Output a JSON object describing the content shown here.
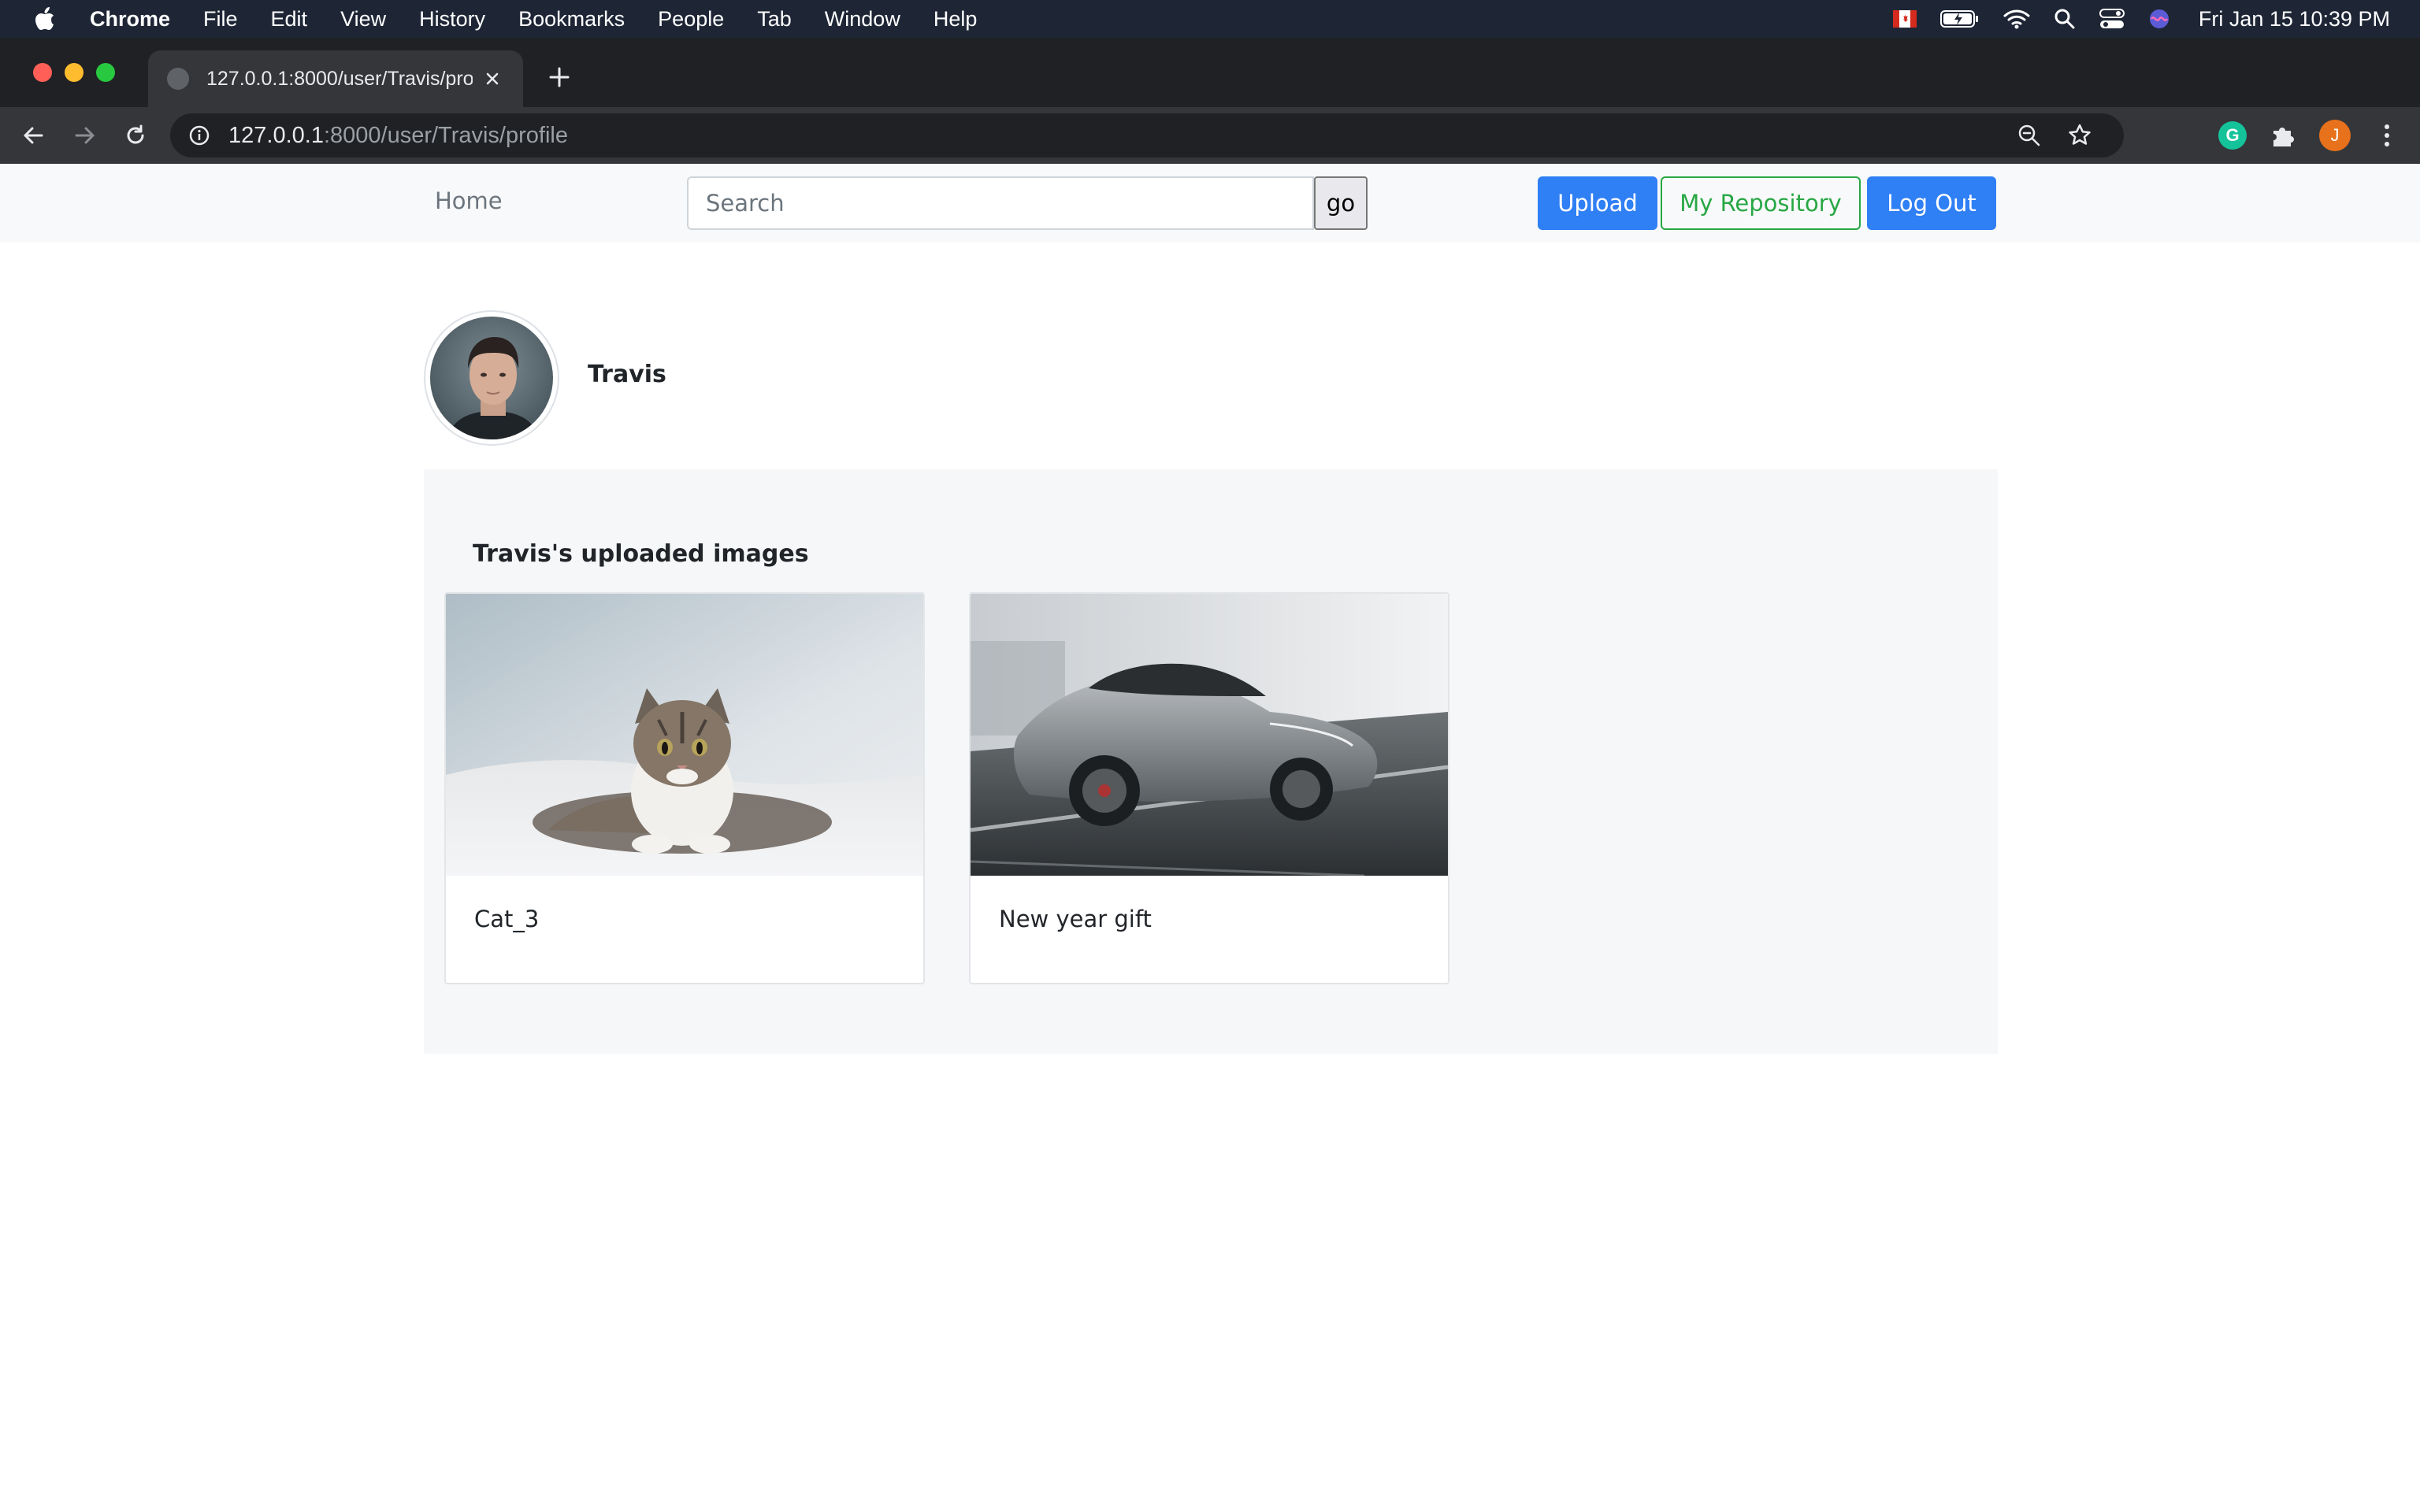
{
  "menubar": {
    "app_name": "Chrome",
    "items": [
      "File",
      "Edit",
      "View",
      "History",
      "Bookmarks",
      "People",
      "Tab",
      "Window",
      "Help"
    ],
    "clock": "Fri Jan 15  10:39 PM"
  },
  "browser": {
    "tab_title": "127.0.0.1:8000/user/Travis/profile",
    "url_host": "127.0.0.1",
    "url_rest": ":8000/user/Travis/profile",
    "profile_initial": "J",
    "extension_g": "G"
  },
  "navbar": {
    "home_label": "Home",
    "search_placeholder": "Search",
    "go_label": "go",
    "upload_label": "Upload",
    "repository_label": "My Repository",
    "logout_label": "Log Out"
  },
  "profile": {
    "username": "Travis"
  },
  "gallery": {
    "title": "Travis's uploaded images",
    "images": [
      {
        "title": "Cat_3",
        "depicts": "cat"
      },
      {
        "title": "New year gift",
        "depicts": "car"
      }
    ]
  },
  "colors": {
    "primary": "#2f7ff5",
    "success": "#28a745",
    "navbar_bg": "#f8f9fa",
    "gallery_bg": "#f6f7f9"
  }
}
